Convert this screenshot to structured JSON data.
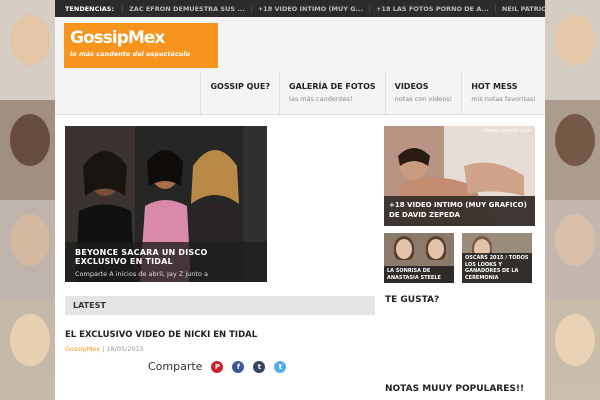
{
  "topbar": {
    "label": "TENDENCIAS:",
    "items": [
      "ZAC EFRON DEMUESTRA SUS ...",
      "+18 VIDEO INTIMO (MUY G...",
      "+18 LAS FOTOS PORNO DE A...",
      "NEIL PATRICK HARRIS DESN..."
    ]
  },
  "logo": {
    "title": "GossipMex",
    "tagline": "lo más candente del espectáculo"
  },
  "nav": [
    {
      "title": "GOSSIP QUE?",
      "sub": ""
    },
    {
      "title": "GALERÍA DE FOTOS",
      "sub": "las más candentes!"
    },
    {
      "title": "VIDEOS",
      "sub": "notas con videos!"
    },
    {
      "title": "HOT MESS",
      "sub": "mis notas favoritas!"
    }
  ],
  "hero": {
    "title": "BEYONCE SACARA UN DISCO EXCLUSIVO EN TIDAL",
    "excerpt": "Comparte A inicios de abril, Jay Z junto a"
  },
  "latest": {
    "label": "LATEST"
  },
  "post": {
    "title": "EL EXCLUSIVO VIDEO DE NICKI EN TIDAL",
    "author": "GossipMex",
    "date": "18/05/2015",
    "share_label": "Comparte"
  },
  "sidebar": {
    "main_caption": "+18 VIDEO INTIMO (MUY GRAFICO) DE DAVID ZEPEDA",
    "watermark": "mboxes.tumblr.com",
    "thumbs": [
      "LA SONRISA DE ANASTASIA STEELE",
      "OSCARS 2015 / TODOS LOS LOOKS Y GANADORES DE LA CEREMONIA"
    ],
    "heading_1": "TE GUSTA?",
    "heading_2": "NOTAS MUUY POPULARES!!"
  },
  "colors": {
    "accent": "#f7941d",
    "topbar": "#2b2b2b"
  },
  "icons": [
    "pinterest-icon",
    "facebook-icon",
    "tumblr-icon",
    "twitter-icon"
  ]
}
